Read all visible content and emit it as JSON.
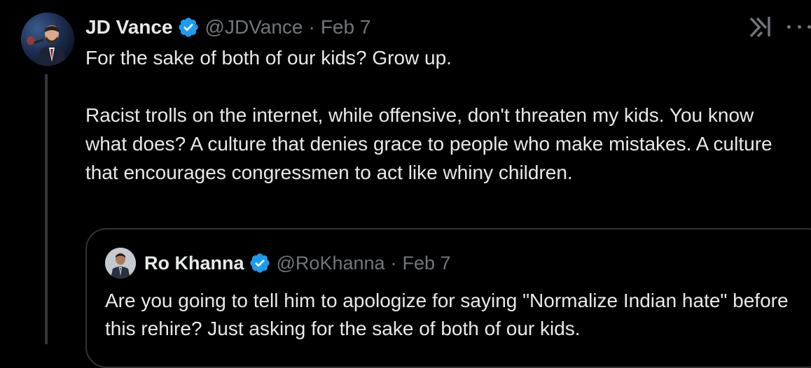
{
  "author": {
    "name": "JD Vance",
    "handle": "@JDVance",
    "separator": "·",
    "date": "Feb 7",
    "verified": true
  },
  "tweet": {
    "paragraphs": [
      "For the sake of both of our kids? Grow up.",
      "Racist trolls on the internet, while offensive, don't threaten my kids. You know what does? A culture that denies grace to people who make mistakes. A culture that encourages congressmen to act like whiny children."
    ]
  },
  "quoted": {
    "author": {
      "name": "Ro Khanna",
      "handle": "@RoKhanna",
      "separator": "·",
      "date": "Feb 7",
      "verified": true
    },
    "text": "Are you going to tell him to apologize for saying \"Normalize Indian hate\" before this rehire? Just asking for the sake of both of our kids."
  },
  "icons": {
    "grok": "grok-icon",
    "more": "more-icon",
    "verified": "verified-badge-icon"
  },
  "colors": {
    "background": "#000000",
    "text_primary": "#e7e9ea",
    "text_secondary": "#71767b",
    "verified_blue": "#1d9bf0",
    "border": "#2f3336"
  }
}
